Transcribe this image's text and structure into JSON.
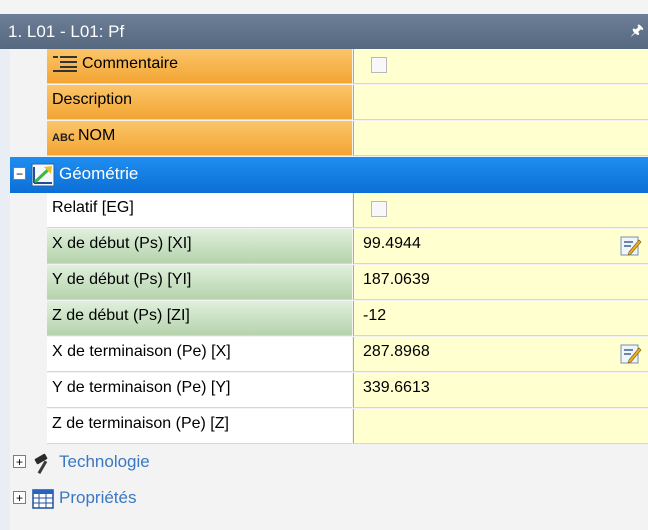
{
  "window": {
    "title": "1. L01 - L01: Pf",
    "pin_icon": "pin-icon"
  },
  "rows": {
    "commentaire": {
      "label": "Commentaire",
      "icon": "comment-lines-icon"
    },
    "description": {
      "label": "Description",
      "value": ""
    },
    "nom": {
      "label": "NOM",
      "icon": "abc-text-icon",
      "value": ""
    },
    "geometrie": {
      "label": "Géométrie",
      "expander": "−",
      "icon": "geometry-icon"
    },
    "relatif": {
      "label": "Relatif [EG]"
    },
    "x_debut": {
      "label": "X de début (Ps) [XI]",
      "value": "99.4944"
    },
    "y_debut": {
      "label": "Y de début (Ps) [YI]",
      "value": "187.0639"
    },
    "z_debut": {
      "label": "Z de début (Ps) [ZI]",
      "value": "-12"
    },
    "x_term": {
      "label": "X de terminaison (Pe) [X]",
      "value": "287.8968"
    },
    "y_term": {
      "label": "Y de terminaison (Pe) [Y]",
      "value": "339.6613"
    },
    "z_term": {
      "label": "Z de terminaison (Pe) [Z]",
      "value": ""
    },
    "technologie": {
      "label": "Technologie",
      "expander": "+",
      "icon": "hammer-icon"
    },
    "proprietes": {
      "label": "Propriétés",
      "expander": "+",
      "icon": "table-icon"
    }
  },
  "colors": {
    "title_bar": "#5d6f86",
    "category_selected": "#1380e6",
    "required_label": "#f5ae40",
    "coordinate_label": "#c6e0c0",
    "value_cell": "#ffffcf"
  }
}
